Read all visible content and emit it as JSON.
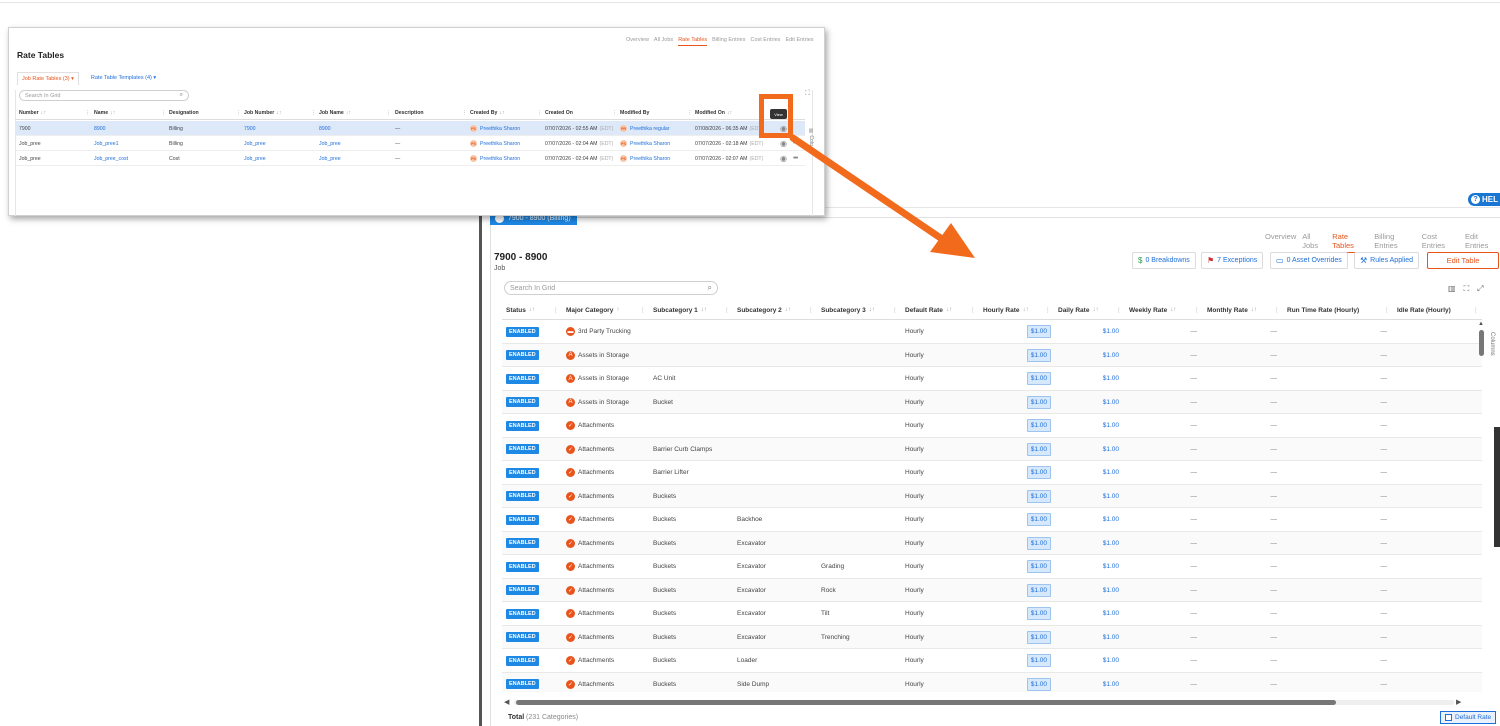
{
  "popup": {
    "title": "Rate Tables",
    "nav": [
      "Overview",
      "All Jobs",
      "Rate Tables",
      "Billing Entries",
      "Cost Entries",
      "Edit Entries"
    ],
    "nav_active": 2,
    "tabs": {
      "job_rate_tables": "Job Rate Tables (3)",
      "rate_table_templates": "Rate Table Templates (4)"
    },
    "search_placeholder": "Search In Grid",
    "columns": [
      "Number",
      "Name",
      "Designation",
      "Job Number",
      "Job Name",
      "Description",
      "Created By",
      "Created On",
      "Modified By",
      "Modified On"
    ],
    "rows": [
      {
        "number": "7900",
        "name": "8900",
        "designation": "Billing",
        "job_number": "7900",
        "job_name": "8900",
        "description": "—",
        "created_by": "Preethika Sharon",
        "created_on": "07/07/2026 - 02:55 AM",
        "created_tz": "(EDT)",
        "modified_by": "Preethika regular",
        "modified_on": "07/08/2026 - 06:35 AM",
        "modified_tz": "(EDT)",
        "initials": "PS",
        "initials2": "PR"
      },
      {
        "number": "Job_pree",
        "name": "Job_pree1",
        "designation": "Billing",
        "job_number": "Job_pree",
        "job_name": "Job_pree",
        "description": "—",
        "created_by": "Preethika Sharon",
        "created_on": "07/07/2026 - 02:04 AM",
        "created_tz": "(EDT)",
        "modified_by": "Preethika Sharon",
        "modified_on": "07/07/2026 - 02:18 AM",
        "modified_tz": "(EDT)",
        "initials": "PS",
        "initials2": "PS"
      },
      {
        "number": "Job_pree",
        "name": "Job_pree_cost",
        "designation": "Cost",
        "job_number": "Job_pree",
        "job_name": "Job_pree",
        "description": "—",
        "created_by": "Preethika Sharon",
        "created_on": "07/07/2026 - 02:04 AM",
        "created_tz": "(EDT)",
        "modified_by": "Preethika Sharon",
        "modified_on": "07/07/2026 - 02:07 AM",
        "modified_tz": "(EDT)",
        "initials": "PS",
        "initials2": "PS"
      }
    ],
    "tooltip": "View"
  },
  "detail": {
    "help_label": "HEL",
    "tab_label": "7900 - 8900 (Billing)",
    "nav": [
      "Overview",
      "All Jobs",
      "Rate Tables",
      "Billing Entries",
      "Cost Entries",
      "Edit Entries"
    ],
    "nav_active": 2,
    "title": "7900 - 8900",
    "subtitle": "Job",
    "buttons": {
      "breakdowns": "0 Breakdowns",
      "exceptions": "7 Exceptions",
      "asset_overrides": "0 Asset Overrides",
      "rules_applied": "Rules Applied",
      "edit_table": "Edit Table"
    },
    "search_placeholder": "Search In Grid",
    "columns": [
      "Status",
      "Major Category",
      "Subcategory 1",
      "Subcategory 2",
      "Subcategory 3",
      "Default Rate",
      "Hourly Rate",
      "Daily Rate",
      "Weekly Rate",
      "Monthly Rate",
      "Run Time Rate (Hourly)",
      "Idle Rate (Hourly)"
    ],
    "side_label": "Columns",
    "rows": [
      {
        "status": "ENABLED",
        "major": "3rd Party Trucking",
        "icon": "truck",
        "sub1": "",
        "sub2": "",
        "sub3": "",
        "default": "Hourly",
        "hourly": "$1.00",
        "daily": "$1.00",
        "weekly": "—",
        "monthly": "—",
        "runtime": "—"
      },
      {
        "status": "ENABLED",
        "major": "Assets in Storage",
        "icon": "A",
        "sub1": "",
        "sub2": "",
        "sub3": "",
        "default": "Hourly",
        "hourly": "$1.00",
        "daily": "$1.00",
        "weekly": "—",
        "monthly": "—",
        "runtime": "—"
      },
      {
        "status": "ENABLED",
        "major": "Assets in Storage",
        "icon": "A",
        "sub1": "AC Unit",
        "sub2": "",
        "sub3": "",
        "default": "Hourly",
        "hourly": "$1.00",
        "daily": "$1.00",
        "weekly": "—",
        "monthly": "—",
        "runtime": "—"
      },
      {
        "status": "ENABLED",
        "major": "Assets in Storage",
        "icon": "A",
        "sub1": "Bucket",
        "sub2": "",
        "sub3": "",
        "default": "Hourly",
        "hourly": "$1.00",
        "daily": "$1.00",
        "weekly": "—",
        "monthly": "—",
        "runtime": "—"
      },
      {
        "status": "ENABLED",
        "major": "Attachments",
        "icon": "check",
        "sub1": "",
        "sub2": "",
        "sub3": "",
        "default": "Hourly",
        "hourly": "$1.00",
        "daily": "$1.00",
        "weekly": "—",
        "monthly": "—",
        "runtime": "—"
      },
      {
        "status": "ENABLED",
        "major": "Attachments",
        "icon": "check",
        "sub1": "Barrier Curb Clamps",
        "sub2": "",
        "sub3": "",
        "default": "Hourly",
        "hourly": "$1.00",
        "daily": "$1.00",
        "weekly": "—",
        "monthly": "—",
        "runtime": "—"
      },
      {
        "status": "ENABLED",
        "major": "Attachments",
        "icon": "check",
        "sub1": "Barrier Lifter",
        "sub2": "",
        "sub3": "",
        "default": "Hourly",
        "hourly": "$1.00",
        "daily": "$1.00",
        "weekly": "—",
        "monthly": "—",
        "runtime": "—"
      },
      {
        "status": "ENABLED",
        "major": "Attachments",
        "icon": "check",
        "sub1": "Buckets",
        "sub2": "",
        "sub3": "",
        "default": "Hourly",
        "hourly": "$1.00",
        "daily": "$1.00",
        "weekly": "—",
        "monthly": "—",
        "runtime": "—"
      },
      {
        "status": "ENABLED",
        "major": "Attachments",
        "icon": "check",
        "sub1": "Buckets",
        "sub2": "Backhoe",
        "sub3": "",
        "default": "Hourly",
        "hourly": "$1.00",
        "daily": "$1.00",
        "weekly": "—",
        "monthly": "—",
        "runtime": "—"
      },
      {
        "status": "ENABLED",
        "major": "Attachments",
        "icon": "check",
        "sub1": "Buckets",
        "sub2": "Excavator",
        "sub3": "",
        "default": "Hourly",
        "hourly": "$1.00",
        "daily": "$1.00",
        "weekly": "—",
        "monthly": "—",
        "runtime": "—"
      },
      {
        "status": "ENABLED",
        "major": "Attachments",
        "icon": "check",
        "sub1": "Buckets",
        "sub2": "Excavator",
        "sub3": "Grading",
        "default": "Hourly",
        "hourly": "$1.00",
        "daily": "$1.00",
        "weekly": "—",
        "monthly": "—",
        "runtime": "—"
      },
      {
        "status": "ENABLED",
        "major": "Attachments",
        "icon": "check",
        "sub1": "Buckets",
        "sub2": "Excavator",
        "sub3": "Rock",
        "default": "Hourly",
        "hourly": "$1.00",
        "daily": "$1.00",
        "weekly": "—",
        "monthly": "—",
        "runtime": "—"
      },
      {
        "status": "ENABLED",
        "major": "Attachments",
        "icon": "check",
        "sub1": "Buckets",
        "sub2": "Excavator",
        "sub3": "Tilt",
        "default": "Hourly",
        "hourly": "$1.00",
        "daily": "$1.00",
        "weekly": "—",
        "monthly": "—",
        "runtime": "—"
      },
      {
        "status": "ENABLED",
        "major": "Attachments",
        "icon": "check",
        "sub1": "Buckets",
        "sub2": "Excavator",
        "sub3": "Trenching",
        "default": "Hourly",
        "hourly": "$1.00",
        "daily": "$1.00",
        "weekly": "—",
        "monthly": "—",
        "runtime": "—"
      },
      {
        "status": "ENABLED",
        "major": "Attachments",
        "icon": "check",
        "sub1": "Buckets",
        "sub2": "Loader",
        "sub3": "",
        "default": "Hourly",
        "hourly": "$1.00",
        "daily": "$1.00",
        "weekly": "—",
        "monthly": "—",
        "runtime": "—"
      },
      {
        "status": "ENABLED",
        "major": "Attachments",
        "icon": "check",
        "sub1": "Buckets",
        "sub2": "Side Dump",
        "sub3": "",
        "default": "Hourly",
        "hourly": "$1.00",
        "daily": "$1.00",
        "weekly": "—",
        "monthly": "—",
        "runtime": "—"
      }
    ],
    "total_label": "Total",
    "total_count": "(231 Categories)",
    "default_rate_label": "Default Rate"
  },
  "colors": {
    "accent_orange": "#e8541c",
    "link_blue": "#1e6fd9",
    "badge_blue": "#1e88e5",
    "highlight": "#f26b1d"
  }
}
